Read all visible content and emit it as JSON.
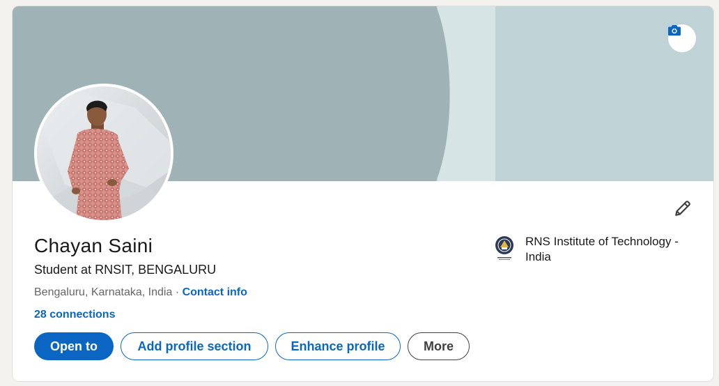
{
  "profile": {
    "name": "Chayan Saini",
    "headline": "Student at RNSIT, BENGALURU",
    "location": "Bengaluru, Karnataka, India",
    "separator": " · ",
    "contact_info": "Contact info",
    "connections": "28 connections"
  },
  "actions": {
    "open_to": "Open to",
    "add_section": "Add profile section",
    "enhance": "Enhance profile",
    "more": "More"
  },
  "education": {
    "school": "RNS Institute of Technology - India"
  },
  "icons": {
    "camera": "camera-icon",
    "edit": "pencil-icon"
  },
  "colors": {
    "accent": "#0a66c2",
    "cover_dark": "#9fb3b6",
    "cover_light": "#bfd3d6"
  }
}
